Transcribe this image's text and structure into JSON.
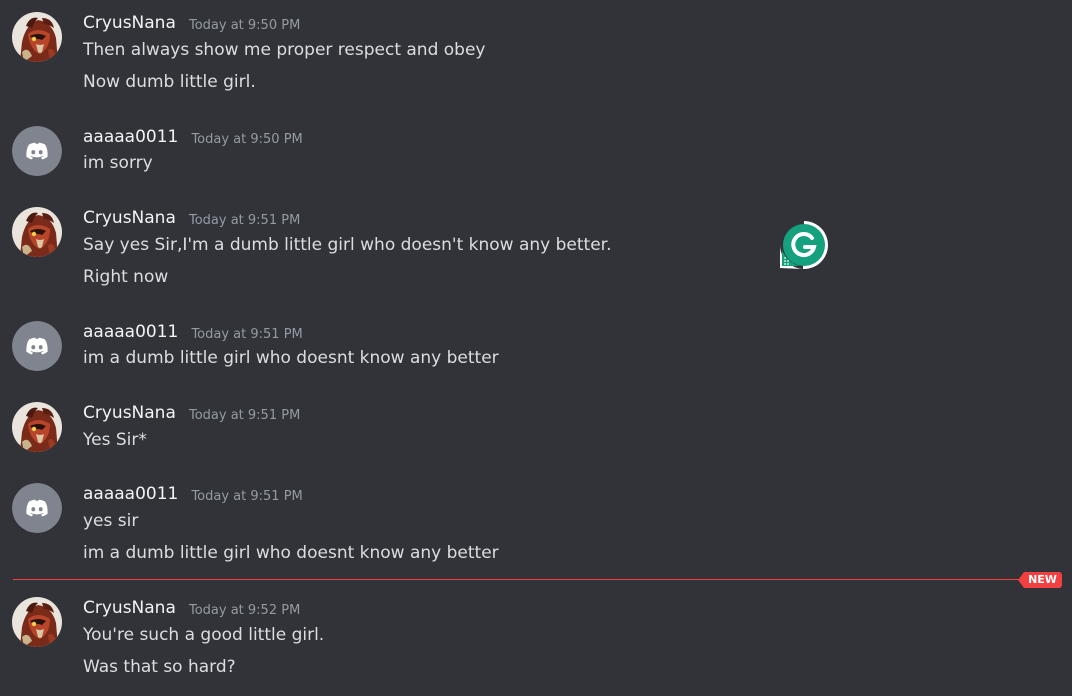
{
  "colors": {
    "background": "#313338",
    "username": "#f2f3f5",
    "timestamp": "#949ba4",
    "message_text": "#dbdee1",
    "new_divider": "#f23f42",
    "discord_avatar_bg": "#80848e",
    "grammarly_green": "#15a07e"
  },
  "messages": [
    {
      "author": "CryusNana",
      "avatar": "red-beast-avatar",
      "time": "Today at 9:50 PM",
      "lines": [
        "Then always show me proper respect and obey",
        "Now dumb little girl."
      ]
    },
    {
      "author": "aaaaa0011",
      "avatar": "discord-default-avatar",
      "time": "Today at 9:50 PM",
      "lines": [
        "im sorry"
      ]
    },
    {
      "author": "CryusNana",
      "avatar": "red-beast-avatar",
      "time": "Today at 9:51 PM",
      "lines": [
        "Say yes Sir,I'm a dumb little girl who doesn't know any better.",
        "Right now"
      ]
    },
    {
      "author": "aaaaa0011",
      "avatar": "discord-default-avatar",
      "time": "Today at 9:51 PM",
      "lines": [
        "im a dumb little girl who doesnt know any better"
      ]
    },
    {
      "author": "CryusNana",
      "avatar": "red-beast-avatar",
      "time": "Today at 9:51 PM",
      "lines": [
        "Yes Sir*"
      ]
    },
    {
      "author": "aaaaa0011",
      "avatar": "discord-default-avatar",
      "time": "Today at 9:51 PM",
      "lines": [
        "yes sir",
        "im a dumb little girl who doesnt know any better"
      ]
    },
    {
      "author": "CryusNana",
      "avatar": "red-beast-avatar",
      "time": "Today at 9:52 PM",
      "lines": [
        "You're such a good little girl.",
        "Was that so hard?"
      ]
    }
  ],
  "new_divider": {
    "label": "NEW"
  },
  "grammarly_widget": {
    "icon": "grammarly-g-icon"
  }
}
